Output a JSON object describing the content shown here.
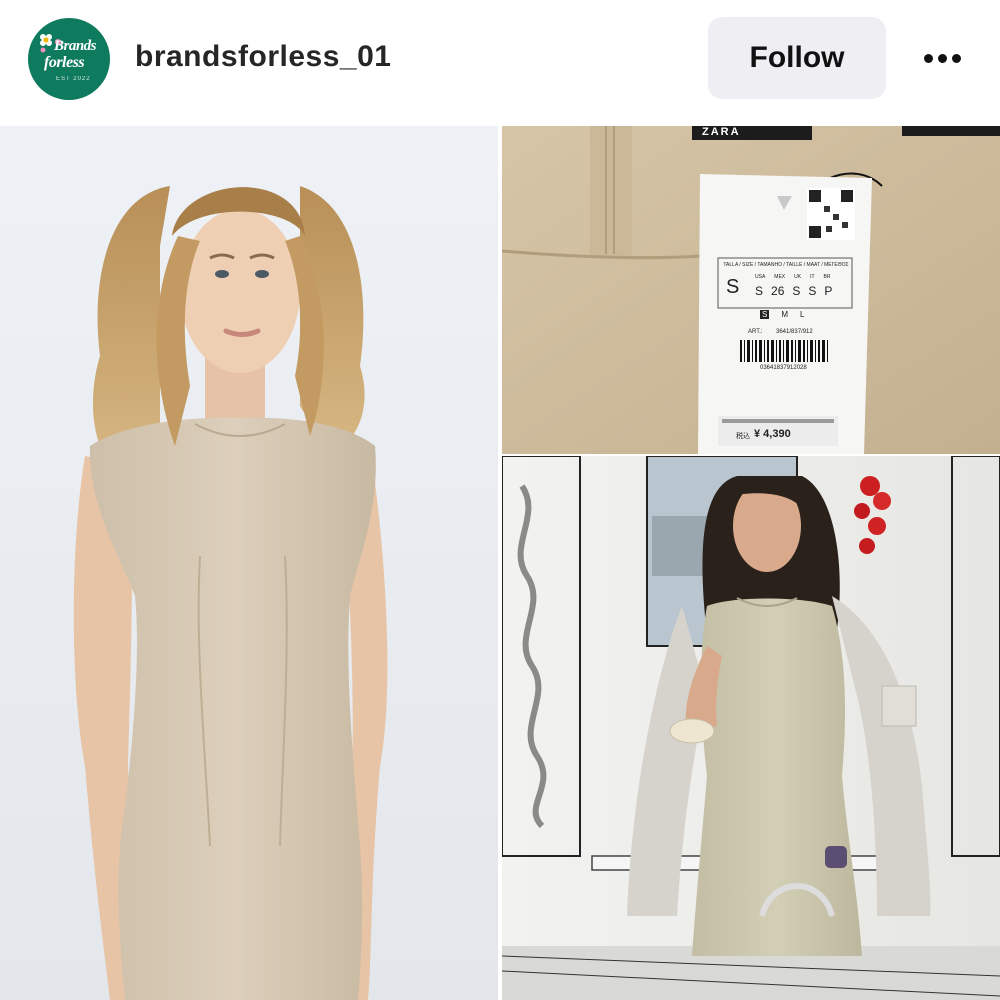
{
  "header": {
    "avatar": {
      "brand_line1": "Brands",
      "brand_line2": "forless",
      "brand_line3": "EST 2022"
    },
    "username": "brandsforless_01",
    "follow_label": "Follow",
    "more_icon": "more-horizontal-icon"
  },
  "post": {
    "photos": [
      {
        "subject": "model-in-beige-dress"
      },
      {
        "subject": "garment-price-tag"
      },
      {
        "subject": "woman-in-dress-with-jacket"
      }
    ],
    "tag": {
      "brand": "ZARA",
      "size_header": "TALLA / SIZE / TAMANHO / TAILLE / MAAT / ΜΕΓΕΘΟΣ",
      "size_main": "S",
      "regions": [
        "USA",
        "MEX",
        "UK",
        "IT",
        "BR"
      ],
      "region_sizes": [
        "S",
        "26",
        "S",
        "S",
        "P"
      ],
      "size_options": [
        "S",
        "M",
        "L"
      ],
      "art_label": "ART.:",
      "art_number": "3641/837/912",
      "barcode_number": "03641837912028",
      "price_prefix": "税込",
      "price": "¥ 4,390"
    }
  },
  "colors": {
    "avatar_bg": "#0e7a5e",
    "follow_bg": "#efeff3",
    "dress_beige": "#d9cbb6",
    "fabric": "#cdbb9c"
  }
}
